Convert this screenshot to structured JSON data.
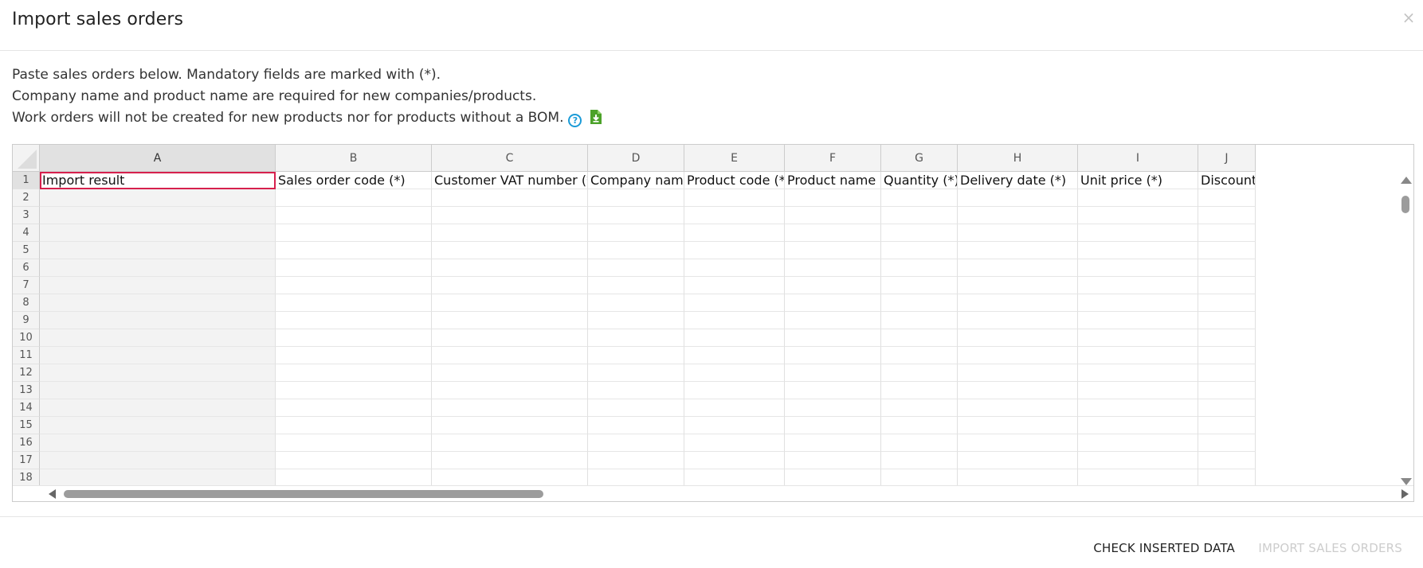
{
  "modal": {
    "title": "Import sales orders",
    "close_label": "×"
  },
  "instructions": {
    "line1": "Paste sales orders below. Mandatory fields are marked with (*).",
    "line2": "Company name and product name are required for new companies/products.",
    "line3": "Work orders will not be created for new products nor for products without a BOM.",
    "help_icon": "question-circle-icon",
    "download_icon": "download-file-icon",
    "help_label": "?"
  },
  "grid": {
    "columns": [
      {
        "letter": "A",
        "header": "Import result"
      },
      {
        "letter": "B",
        "header": "Sales order code (*)"
      },
      {
        "letter": "C",
        "header": "Customer VAT number (*)"
      },
      {
        "letter": "D",
        "header": "Company name"
      },
      {
        "letter": "E",
        "header": "Product code (*)"
      },
      {
        "letter": "F",
        "header": "Product name"
      },
      {
        "letter": "G",
        "header": "Quantity (*)"
      },
      {
        "letter": "H",
        "header": "Delivery date (*)"
      },
      {
        "letter": "I",
        "header": "Unit price (*)"
      },
      {
        "letter": "J",
        "header": "Discount (%)"
      }
    ],
    "row_numbers": [
      "1",
      "2",
      "3",
      "4",
      "5",
      "6",
      "7",
      "8",
      "9",
      "10",
      "11",
      "12",
      "13",
      "14",
      "15",
      "16",
      "17",
      "18"
    ],
    "selected_cell": "A1",
    "selection_color": "#d6204d"
  },
  "footer": {
    "check_label": "CHECK INSERTED DATA",
    "import_label": "IMPORT SALES ORDERS",
    "import_disabled": true
  },
  "colors": {
    "help_icon": "#1b9bd7",
    "download_icon": "#4ca22a",
    "disabled_text": "#cdcdcd"
  }
}
